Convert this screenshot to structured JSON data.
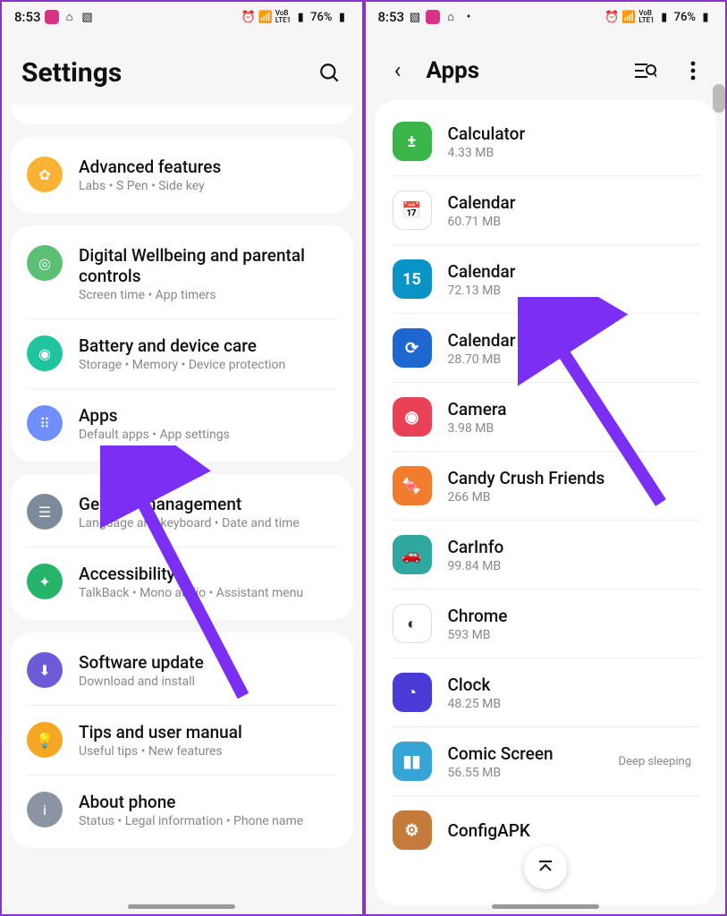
{
  "status": {
    "time": "8:53",
    "battery": "76%"
  },
  "left": {
    "title": "Settings",
    "groups": [
      [
        {
          "icon": "advanced",
          "color": "#f9b233",
          "title": "Advanced features",
          "sub": "Labs  •  S Pen  •  Side key"
        }
      ],
      [
        {
          "icon": "wellbeing",
          "color": "#5bbf74",
          "title": "Digital Wellbeing and parental controls",
          "sub": "Screen time  •  App timers"
        },
        {
          "icon": "battery",
          "color": "#20c5a0",
          "title": "Battery and device care",
          "sub": "Storage  •  Memory  •  Device protection"
        },
        {
          "icon": "apps",
          "color": "#6f8eff",
          "title": "Apps",
          "sub": "Default apps  •  App settings"
        }
      ],
      [
        {
          "icon": "general",
          "color": "#7d8a9a",
          "title": "General management",
          "sub": "Language and keyboard  •  Date and time"
        },
        {
          "icon": "accessibility",
          "color": "#27b36a",
          "title": "Accessibility",
          "sub": "TalkBack  •  Mono audio  •  Assistant menu"
        }
      ],
      [
        {
          "icon": "update",
          "color": "#6b5bd6",
          "title": "Software update",
          "sub": "Download and install"
        },
        {
          "icon": "tips",
          "color": "#f5a623",
          "title": "Tips and user manual",
          "sub": "Useful tips  •  New features"
        },
        {
          "icon": "about",
          "color": "#8a94a3",
          "title": "About phone",
          "sub": "Status  •  Legal information  •  Phone name"
        }
      ]
    ]
  },
  "right": {
    "title": "Apps",
    "apps": [
      {
        "name": "Calculator",
        "size": "4.33 MB",
        "color": "#3bb54a",
        "glyph": "±"
      },
      {
        "name": "Calendar",
        "size": "60.71 MB",
        "color": "#ffffff",
        "glyph": "📅"
      },
      {
        "name": "Calendar",
        "size": "72.13 MB",
        "color": "#0a93c5",
        "glyph": "15"
      },
      {
        "name": "Calendar Backup",
        "size": "28.70 MB",
        "color": "#1e66d0",
        "glyph": "⟳"
      },
      {
        "name": "Camera",
        "size": "3.98 MB",
        "color": "#e94256",
        "glyph": "◉"
      },
      {
        "name": "Candy Crush Friends",
        "size": "266 MB",
        "color": "#f07c2d",
        "glyph": "🍬"
      },
      {
        "name": "CarInfo",
        "size": "99.84 MB",
        "color": "#2fa8a0",
        "glyph": "🚗"
      },
      {
        "name": "Chrome",
        "size": "593 MB",
        "color": "#ffffff",
        "glyph": "◐"
      },
      {
        "name": "Clock",
        "size": "48.25 MB",
        "color": "#4a3bd6",
        "glyph": "◔"
      },
      {
        "name": "Comic Screen",
        "size": "56.55 MB",
        "color": "#36a5d6",
        "glyph": "▮▮",
        "badge": "Deep sleeping"
      },
      {
        "name": "ConfigAPK",
        "size": "",
        "color": "#c47a3a",
        "glyph": "⚙"
      }
    ]
  }
}
